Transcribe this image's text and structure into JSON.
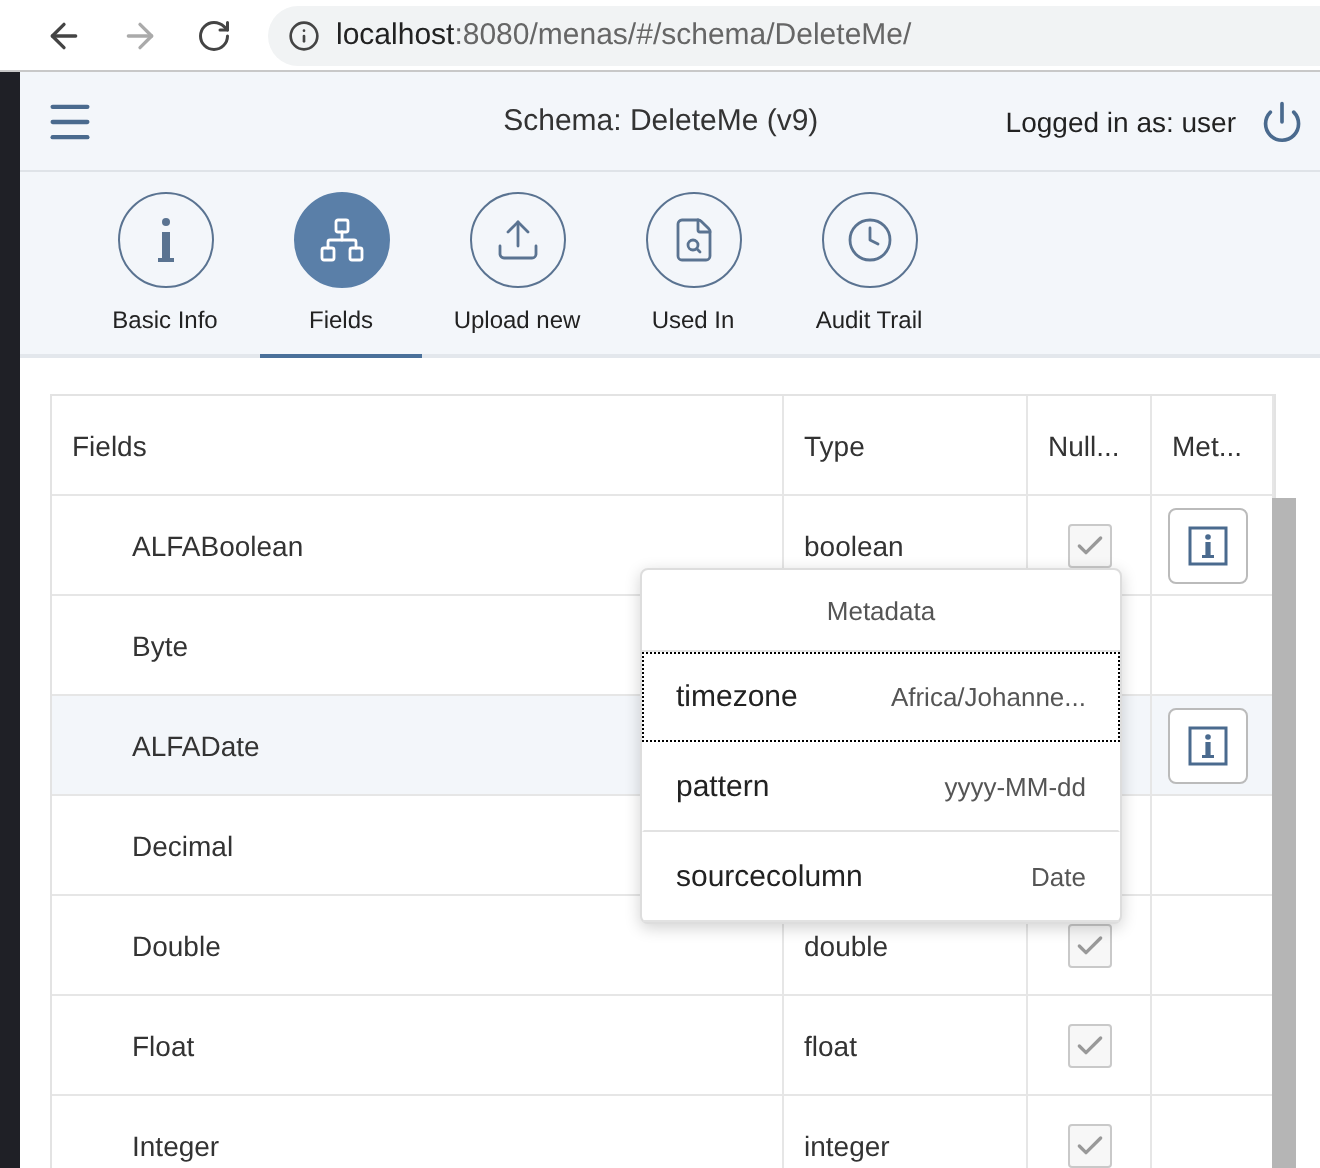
{
  "browser": {
    "url_host": "localhost",
    "url_path": ":8080/menas/#/schema/DeleteMe/"
  },
  "header": {
    "title": "Schema: DeleteMe (v9)",
    "user": "Logged in as: user"
  },
  "tabs": [
    {
      "label": "Basic Info",
      "selected": false
    },
    {
      "label": "Fields",
      "selected": true
    },
    {
      "label": "Upload new",
      "selected": false
    },
    {
      "label": "Used In",
      "selected": false
    },
    {
      "label": "Audit Trail",
      "selected": false
    }
  ],
  "table": {
    "columns": [
      "Fields",
      "Type",
      "Null...",
      "Met..."
    ],
    "rows": [
      {
        "name": "ALFABoolean",
        "type": "boolean",
        "nullable": true,
        "metadata": true,
        "selected": false
      },
      {
        "name": "Byte",
        "selected": false
      },
      {
        "name": "ALFADate",
        "metadata": true,
        "selected": true
      },
      {
        "name": "Decimal",
        "selected": false
      },
      {
        "name": "Double",
        "type": "double",
        "nullable": true,
        "selected": false
      },
      {
        "name": "Float",
        "type": "float",
        "nullable": true,
        "selected": false
      },
      {
        "name": "Integer",
        "type": "integer",
        "nullable": true,
        "selected": false
      }
    ]
  },
  "popover": {
    "title": "Metadata",
    "items": [
      {
        "key": "timezone",
        "value": "Africa/Johanne...",
        "focused": true
      },
      {
        "key": "pattern",
        "value": "yyyy-MM-dd",
        "focused": false
      },
      {
        "key": "sourcecolumn",
        "value": "Date",
        "focused": false
      }
    ]
  }
}
